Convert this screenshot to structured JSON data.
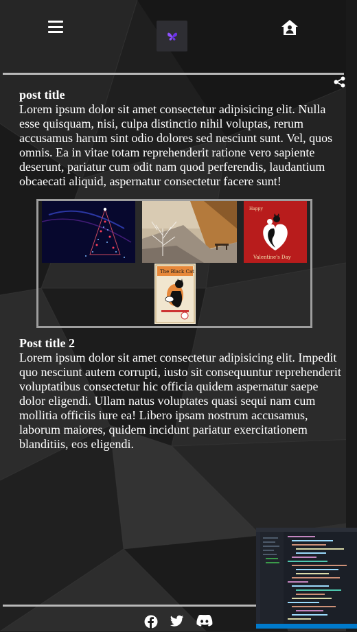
{
  "header": {
    "menu_icon": "hamburger-menu-icon",
    "logo_icon": "butterfly-icon",
    "home_icon": "home-user-icon",
    "share_icon": "share-icon"
  },
  "posts": [
    {
      "title": "post title",
      "body": "Lorem ipsum dolor sit amet consectetur adipisicing elit. Nulla esse quisquam, nisi, culpa distinctio nihil voluptas, rerum accusamus harum sint odio dolores sed nesciunt sunt. Vel, quos omnis. Ea in vitae totam reprehenderit ratione vero sapiente deserunt, pariatur cum odit nam quod perferendis, laudantium obcaecati aliquid, aspernatur consectetur facere sunt!"
    },
    {
      "title": "Post title 2",
      "body": "Lorem ipsum dolor sit amet consectetur adipisicing elit. Impedit quo nesciunt autem corrupti, iusto sit consequuntur reprehenderit voluptatibus consectetur hic officia quidem aspernatur saepe dolor eligendi. Ullam natus voluptates quasi sequi nam cum mollitia officiis iure ea! Libero ipsam nostrum accusamus, laborum maiores, quidem incidunt pariatur exercitationem blanditiis, eos eligendi."
    }
  ],
  "gallery": {
    "images": [
      {
        "name": "christmas-tree-image"
      },
      {
        "name": "autumn-landscape-image"
      },
      {
        "name": "valentines-day-image",
        "caption_top": "Happy",
        "caption_bottom": "Valentine's Day"
      },
      {
        "name": "black-cat-poster-image",
        "caption": "The Black Cat"
      }
    ]
  },
  "footer": {
    "icons": [
      "facebook-icon",
      "twitter-icon",
      "discord-icon"
    ]
  },
  "colors": {
    "background": "#1e1e1e",
    "rule": "#b9b9b9",
    "gallery_border": "#9e9e9e",
    "text": "#ffffff"
  }
}
